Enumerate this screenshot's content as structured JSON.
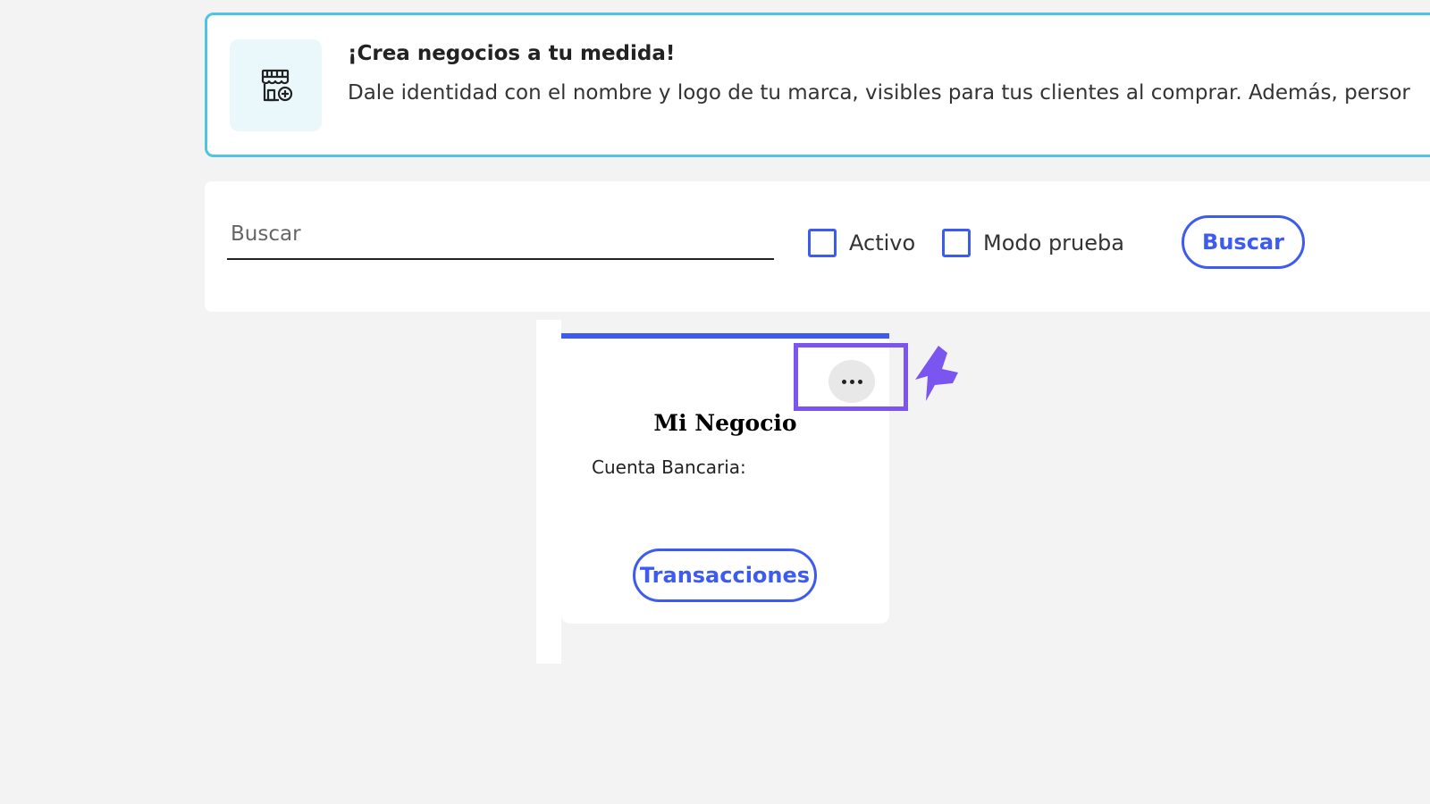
{
  "banner": {
    "icon": "store-add-icon",
    "title": "¡Crea negocios a tu medida!",
    "text": "Dale identidad con el nombre y logo de tu marca, visibles para tus clientes al comprar. Además, persor"
  },
  "search": {
    "placeholder": "Buscar",
    "value": "",
    "filters": [
      {
        "label": "Activo",
        "checked": false
      },
      {
        "label": "Modo prueba",
        "checked": false
      }
    ],
    "button_label": "Buscar"
  },
  "business_card": {
    "name": "Mi Negocio",
    "bank_account_label": "Cuenta Bancaria:",
    "bank_account_value": "",
    "menu_icon": "more-horizontal-icon",
    "transactions_button_label": "Transacciones"
  },
  "colors": {
    "accent": "#3d5bf0",
    "banner_border": "#4dc3e6",
    "highlight": "#7a55f0",
    "background": "#f3f3f3"
  }
}
